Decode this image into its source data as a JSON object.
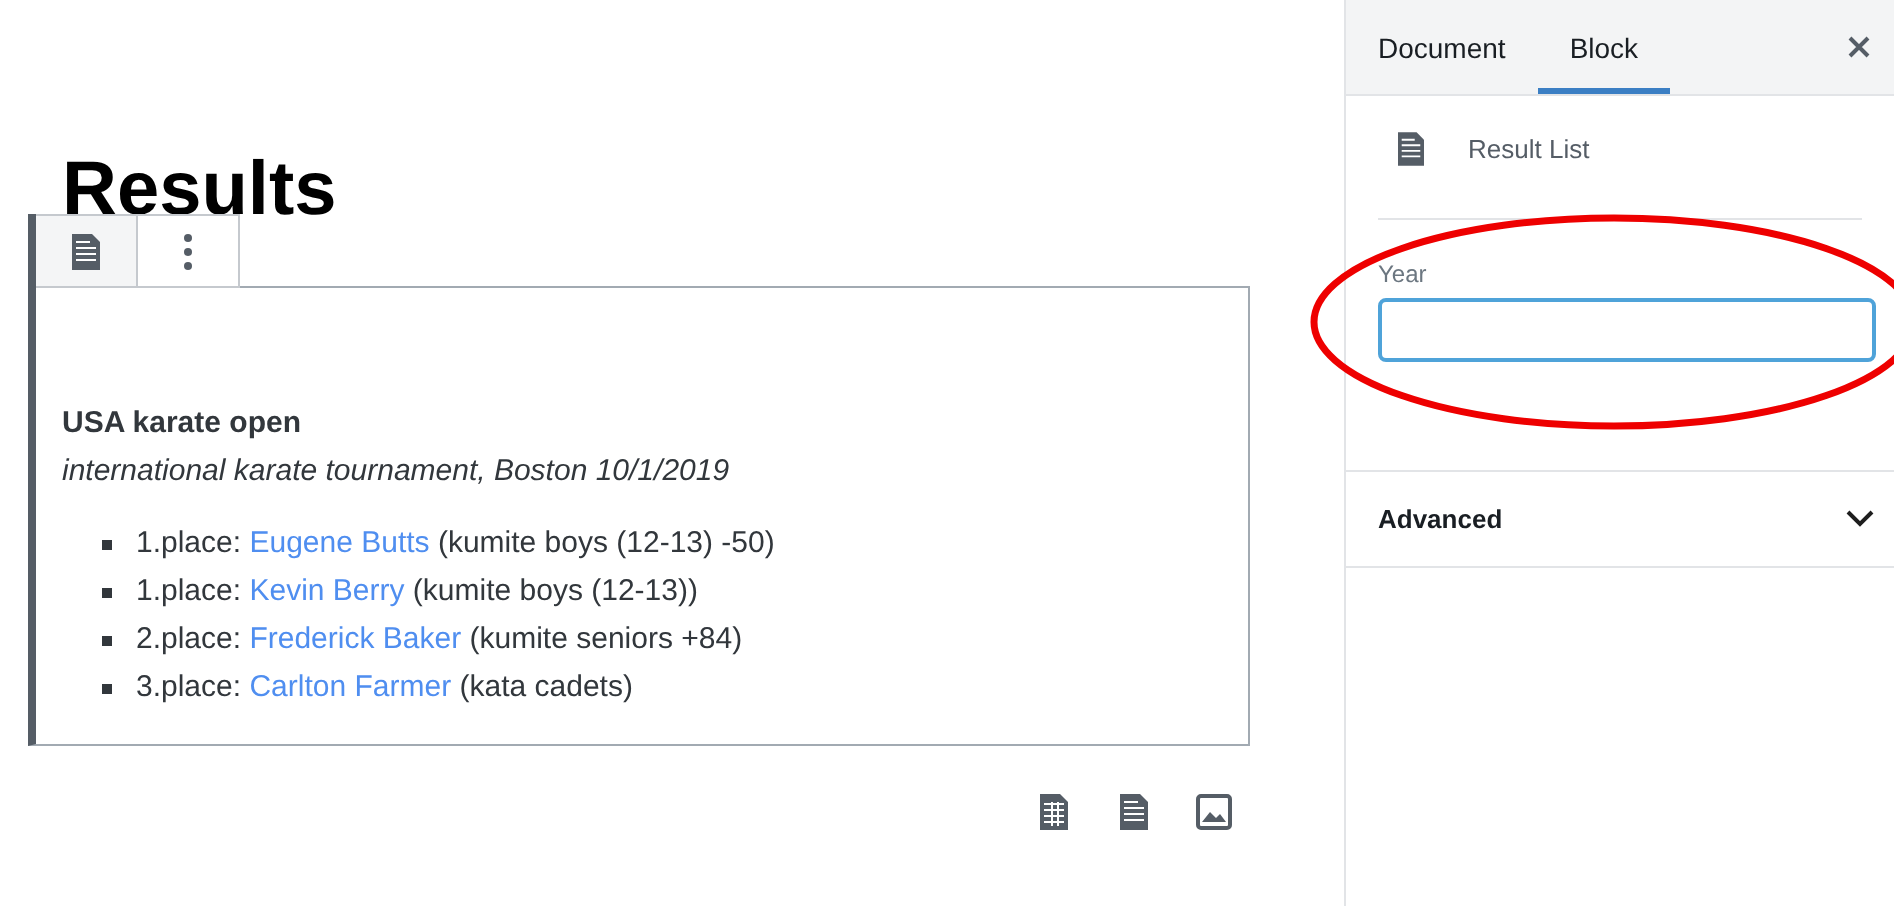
{
  "editor": {
    "title": "Results",
    "block_toolbar": {
      "buttons": [
        {
          "kind": "block-type"
        },
        {
          "kind": "more"
        }
      ]
    },
    "block": {
      "heading": "USA karate open",
      "subtitle": "international karate tournament, Boston 10/1/2019",
      "results": [
        {
          "place": "1.place:",
          "name": "Eugene Butts",
          "detail": "(kumite boys (12-13) -50)"
        },
        {
          "place": "1.place:",
          "name": "Kevin Berry",
          "detail": "(kumite boys (12-13))"
        },
        {
          "place": "2.place:",
          "name": "Frederick Baker",
          "detail": "(kumite seniors +84)"
        },
        {
          "place": "3.place:",
          "name": "Carlton Farmer",
          "detail": "(kata cadets)"
        }
      ]
    },
    "inserter": [
      {
        "kind": "table"
      },
      {
        "kind": "document"
      },
      {
        "kind": "image"
      }
    ]
  },
  "sidebar": {
    "tabs": [
      {
        "label": "Document",
        "selected": false
      },
      {
        "label": "Block",
        "selected": true
      }
    ],
    "block_card": {
      "name": "Result List"
    },
    "fields": [
      {
        "label": "Year"
      }
    ],
    "panels": [
      {
        "title": "Advanced",
        "expanded": false
      }
    ]
  },
  "annotation": {
    "kind": "ellipse"
  }
}
